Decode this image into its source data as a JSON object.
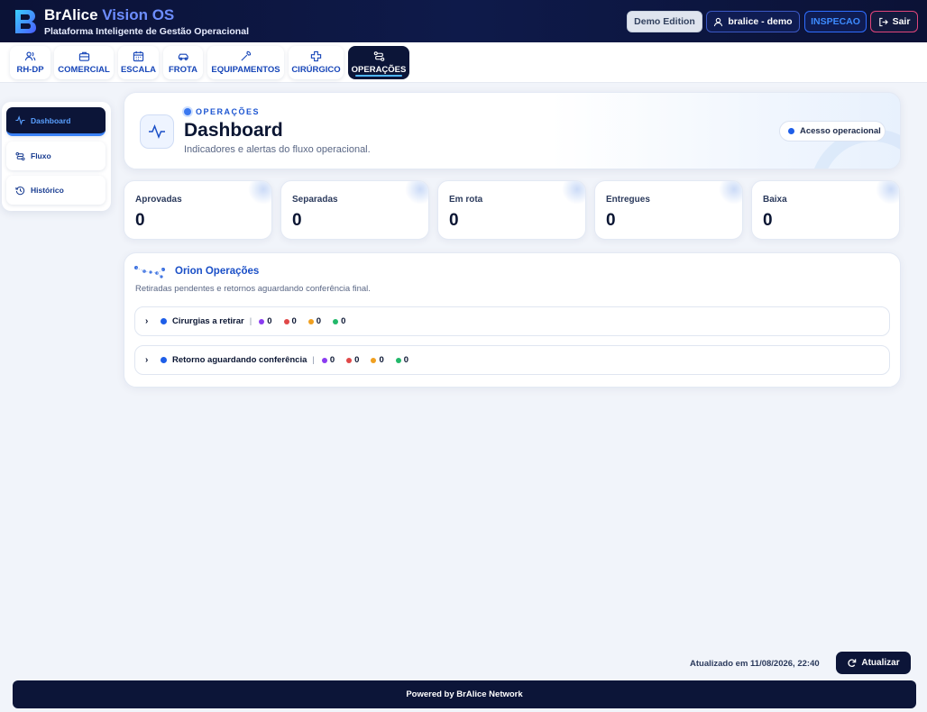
{
  "header": {
    "brand_name": "BrAlice",
    "brand_accent": "Vision OS",
    "subtitle": "Plataforma Inteligente de Gestão Operacional",
    "demo_label": "Demo Edition",
    "user_label": "bralice - demo",
    "inspect_label": "INSPECAO",
    "logout_label": "Sair"
  },
  "modules": [
    {
      "label": "RH-DP",
      "icon": "users-icon"
    },
    {
      "label": "COMERCIAL",
      "icon": "briefcase-icon"
    },
    {
      "label": "ESCALA",
      "icon": "calendar-icon"
    },
    {
      "label": "FROTA",
      "icon": "car-icon"
    },
    {
      "label": "EQUIPAMENTOS",
      "icon": "wrench-icon"
    },
    {
      "label": "CIRÚRGICO",
      "icon": "cross-icon"
    },
    {
      "label": "OPERAÇÕES",
      "icon": "route-icon",
      "active": true
    }
  ],
  "sidebar": {
    "items": [
      {
        "label": "Dashboard",
        "icon": "activity-icon",
        "active": true
      },
      {
        "label": "Fluxo",
        "icon": "route-icon"
      },
      {
        "label": "Histórico",
        "icon": "history-icon"
      }
    ]
  },
  "hero": {
    "eyebrow": "OPERAÇÕES",
    "title": "Dashboard",
    "subtitle": "Indicadores e alertas do fluxo operacional.",
    "access_label": "Acesso operacional"
  },
  "stats": [
    {
      "label": "Aprovadas",
      "value": "0"
    },
    {
      "label": "Separadas",
      "value": "0"
    },
    {
      "label": "Em rota",
      "value": "0"
    },
    {
      "label": "Entregues",
      "value": "0"
    },
    {
      "label": "Baixa",
      "value": "0"
    }
  ],
  "orion": {
    "title": "Orion Operações",
    "subtitle": "Retiradas pendentes e retornos aguardando conferência final.",
    "rows": [
      {
        "label": "Cirurgias a retirar",
        "counts": [
          "0",
          "0",
          "0",
          "0"
        ]
      },
      {
        "label": "Retorno aguardando conferência",
        "counts": [
          "0",
          "0",
          "0",
          "0"
        ]
      }
    ],
    "count_colors": [
      "#8b3cf0",
      "#e04848",
      "#f0a020",
      "#22b86a"
    ]
  },
  "footer": {
    "updated_text": "Atualizado em 11/08/2026, 22:40",
    "refresh_label": "Atualizar",
    "powered_text": "Powered by BrAlice Network"
  },
  "colors": {
    "navy": "#0c1538",
    "accent_blue": "#1e5ee8",
    "brand_accent": "#6d8dff"
  }
}
